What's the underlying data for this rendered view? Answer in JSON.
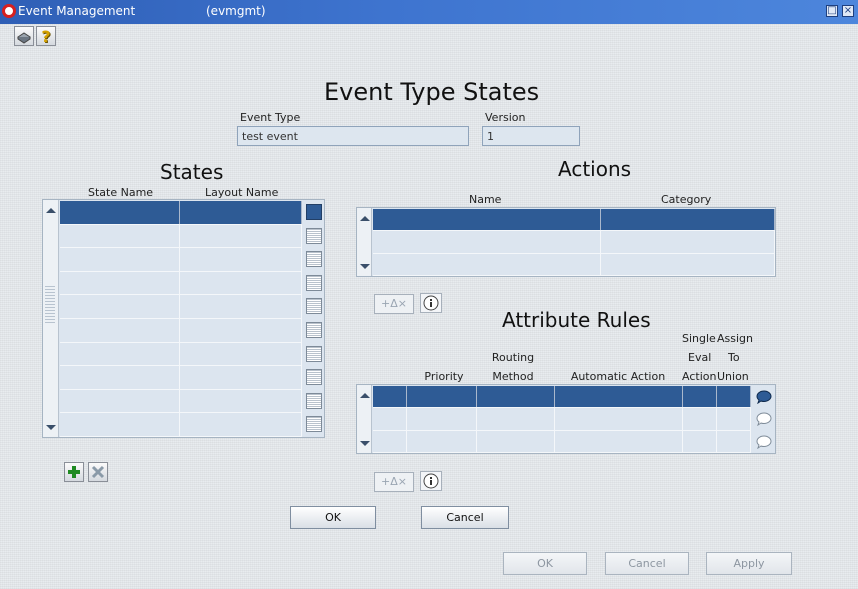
{
  "window": {
    "title": "Event Management",
    "module": "(evmgmt)",
    "brand_color": "#d6201f"
  },
  "toolbar": {
    "items": [
      {
        "name": "save-icon",
        "interactable": true
      },
      {
        "name": "help-icon",
        "glyph": "?",
        "interactable": true
      }
    ]
  },
  "page": {
    "title": "Event Type States",
    "event_type_label": "Event Type",
    "event_type_value": "test event",
    "version_label": "Version",
    "version_value": "1"
  },
  "states": {
    "heading": "States",
    "columns": [
      "State Name",
      "Layout Name"
    ],
    "row_count": 10,
    "add_icon": "plus-icon",
    "delete_icon": "delete-x-icon"
  },
  "actions": {
    "heading": "Actions",
    "columns": [
      "Name",
      "Category"
    ],
    "row_count": 3,
    "toolbar_label": "+Δ×"
  },
  "attribute_rules": {
    "heading": "Attribute Rules",
    "columns": [
      {
        "line1": "",
        "line2": "",
        "line3": "Priority"
      },
      {
        "line1": "",
        "line2": "Routing",
        "line3": "Method"
      },
      {
        "line1": "",
        "line2": "",
        "line3": "Automatic Action"
      },
      {
        "line1": "Single",
        "line2": "Eval",
        "line3": "Action"
      },
      {
        "line1": "Assign",
        "line2": "To",
        "line3": "Union"
      }
    ],
    "row_count": 3,
    "toolbar_label": "+Δ×"
  },
  "dialog_buttons": {
    "ok": "OK",
    "cancel": "Cancel"
  },
  "footer_buttons": {
    "ok": "OK",
    "cancel": "Cancel",
    "apply": "Apply"
  },
  "colors": {
    "selected_row": "#2e5b95",
    "grid_bg": "#dce5ef",
    "titlebar": "#3e74cf"
  }
}
